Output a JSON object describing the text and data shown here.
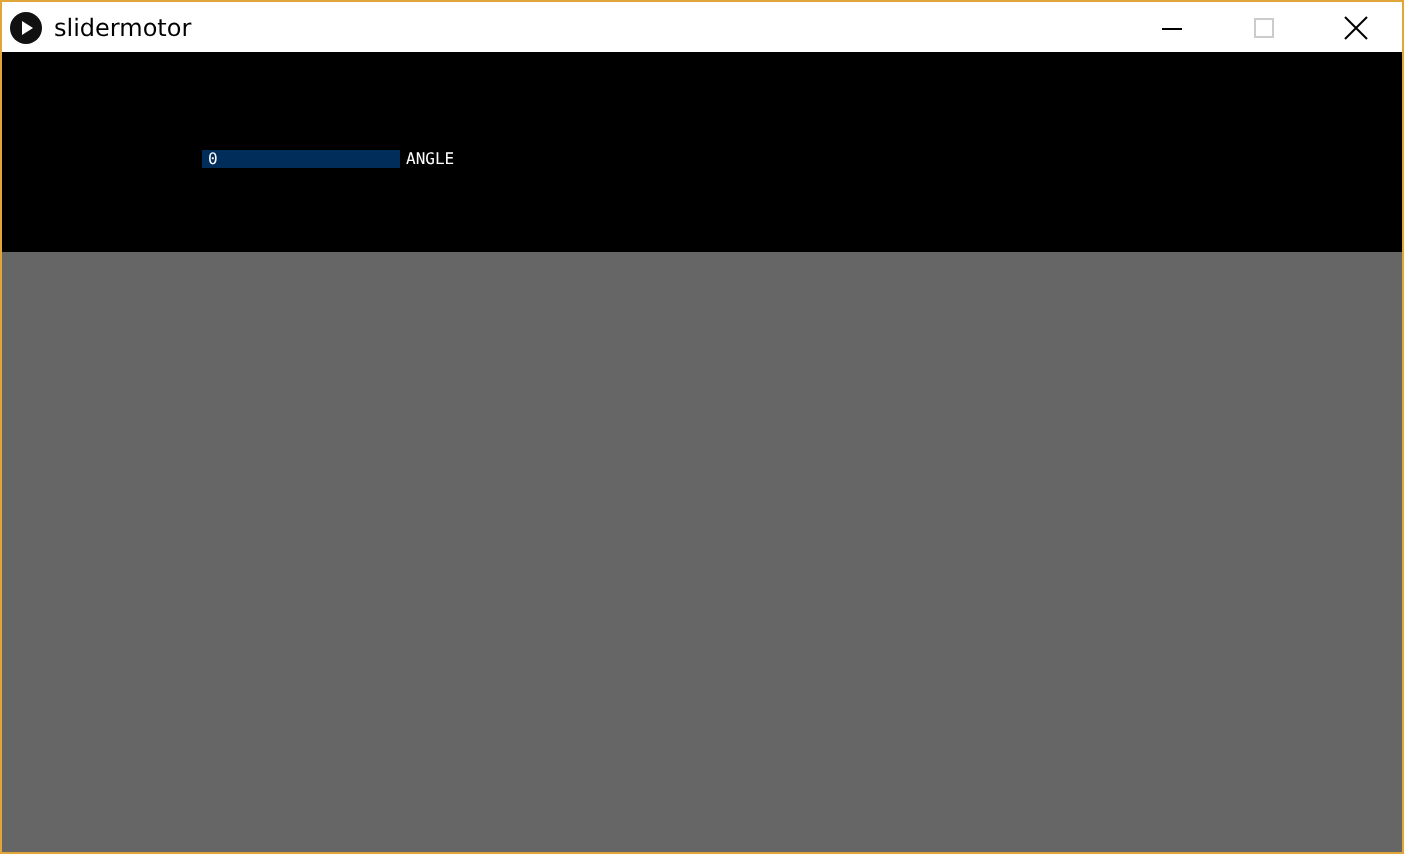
{
  "window": {
    "title": "slidermotor"
  },
  "slider": {
    "value": "0",
    "label": "ANGLE",
    "level": 0
  }
}
